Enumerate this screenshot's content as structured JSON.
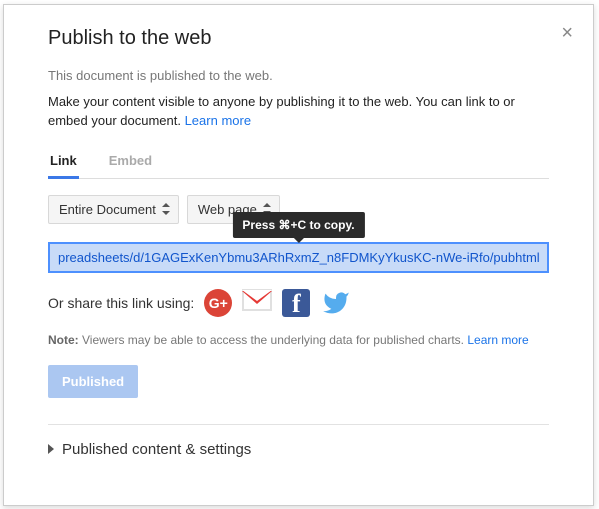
{
  "dialog": {
    "title": "Publish to the web",
    "status": "This document is published to the web.",
    "description_prefix": "Make your content visible to anyone by publishing it to the web. You can link to or embed your document. ",
    "learn_more": "Learn more",
    "tabs": {
      "link": "Link",
      "embed": "Embed"
    },
    "scope_select": "Entire Document",
    "format_select": "Web page",
    "tooltip": "Press ⌘+C to copy.",
    "url_value": "preadsheets/d/1GAGExKenYbmu3ARhRxmZ_n8FDMKyYkusKC-nWe-iRfo/pubhtml",
    "share_label": "Or share this link using:",
    "note_label": "Note:",
    "note_text": " Viewers may be able to access the underlying data for published charts. ",
    "note_learn_more": "Learn more",
    "published_btn": "Published",
    "expander": "Published content & settings",
    "gplus_label": "G+"
  }
}
